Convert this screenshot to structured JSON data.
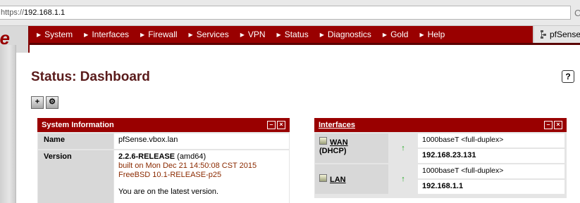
{
  "browser": {
    "scheme": "https://",
    "host": "192.168.1.1",
    "reload_glyph": "C"
  },
  "logo": {
    "text": "se"
  },
  "nav": {
    "items": [
      {
        "label": "System"
      },
      {
        "label": "Interfaces"
      },
      {
        "label": "Firewall"
      },
      {
        "label": "Services"
      },
      {
        "label": "VPN"
      },
      {
        "label": "Status"
      },
      {
        "label": "Diagnostics"
      },
      {
        "label": "Gold"
      },
      {
        "label": "Help"
      }
    ],
    "brand": "pfSense"
  },
  "page": {
    "title": "Status: Dashboard",
    "help_glyph": "?",
    "icons": [
      "add-widget-icon",
      "settings-icon"
    ]
  },
  "system_info": {
    "title": "System Information",
    "name_label": "Name",
    "name_value": "pfSense.vbox.lan",
    "version_label": "Version",
    "version_bold": "2.2.6-RELEASE",
    "version_arch": "(amd64)",
    "built_on": "built on Mon Dec 21 14:50:08 CST 2015",
    "freebsd": "FreeBSD 10.1-RELEASE-p25",
    "latest": "You are on the latest version."
  },
  "interfaces": {
    "title": "Interfaces",
    "rows": [
      {
        "name": "WAN",
        "sub": "(DHCP)",
        "media": "1000baseT <full-duplex>",
        "ip": "192.168.23.131",
        "status": "up"
      },
      {
        "name": "LAN",
        "sub": "",
        "media": "1000baseT <full-duplex>",
        "ip": "192.168.1.1",
        "status": "up"
      }
    ]
  },
  "colors": {
    "nav_bg": "#990000",
    "header_bg": "#990000",
    "title_color": "#5a1b1b",
    "status_up": "#1fa81f",
    "version_text": "#8b2a00"
  }
}
